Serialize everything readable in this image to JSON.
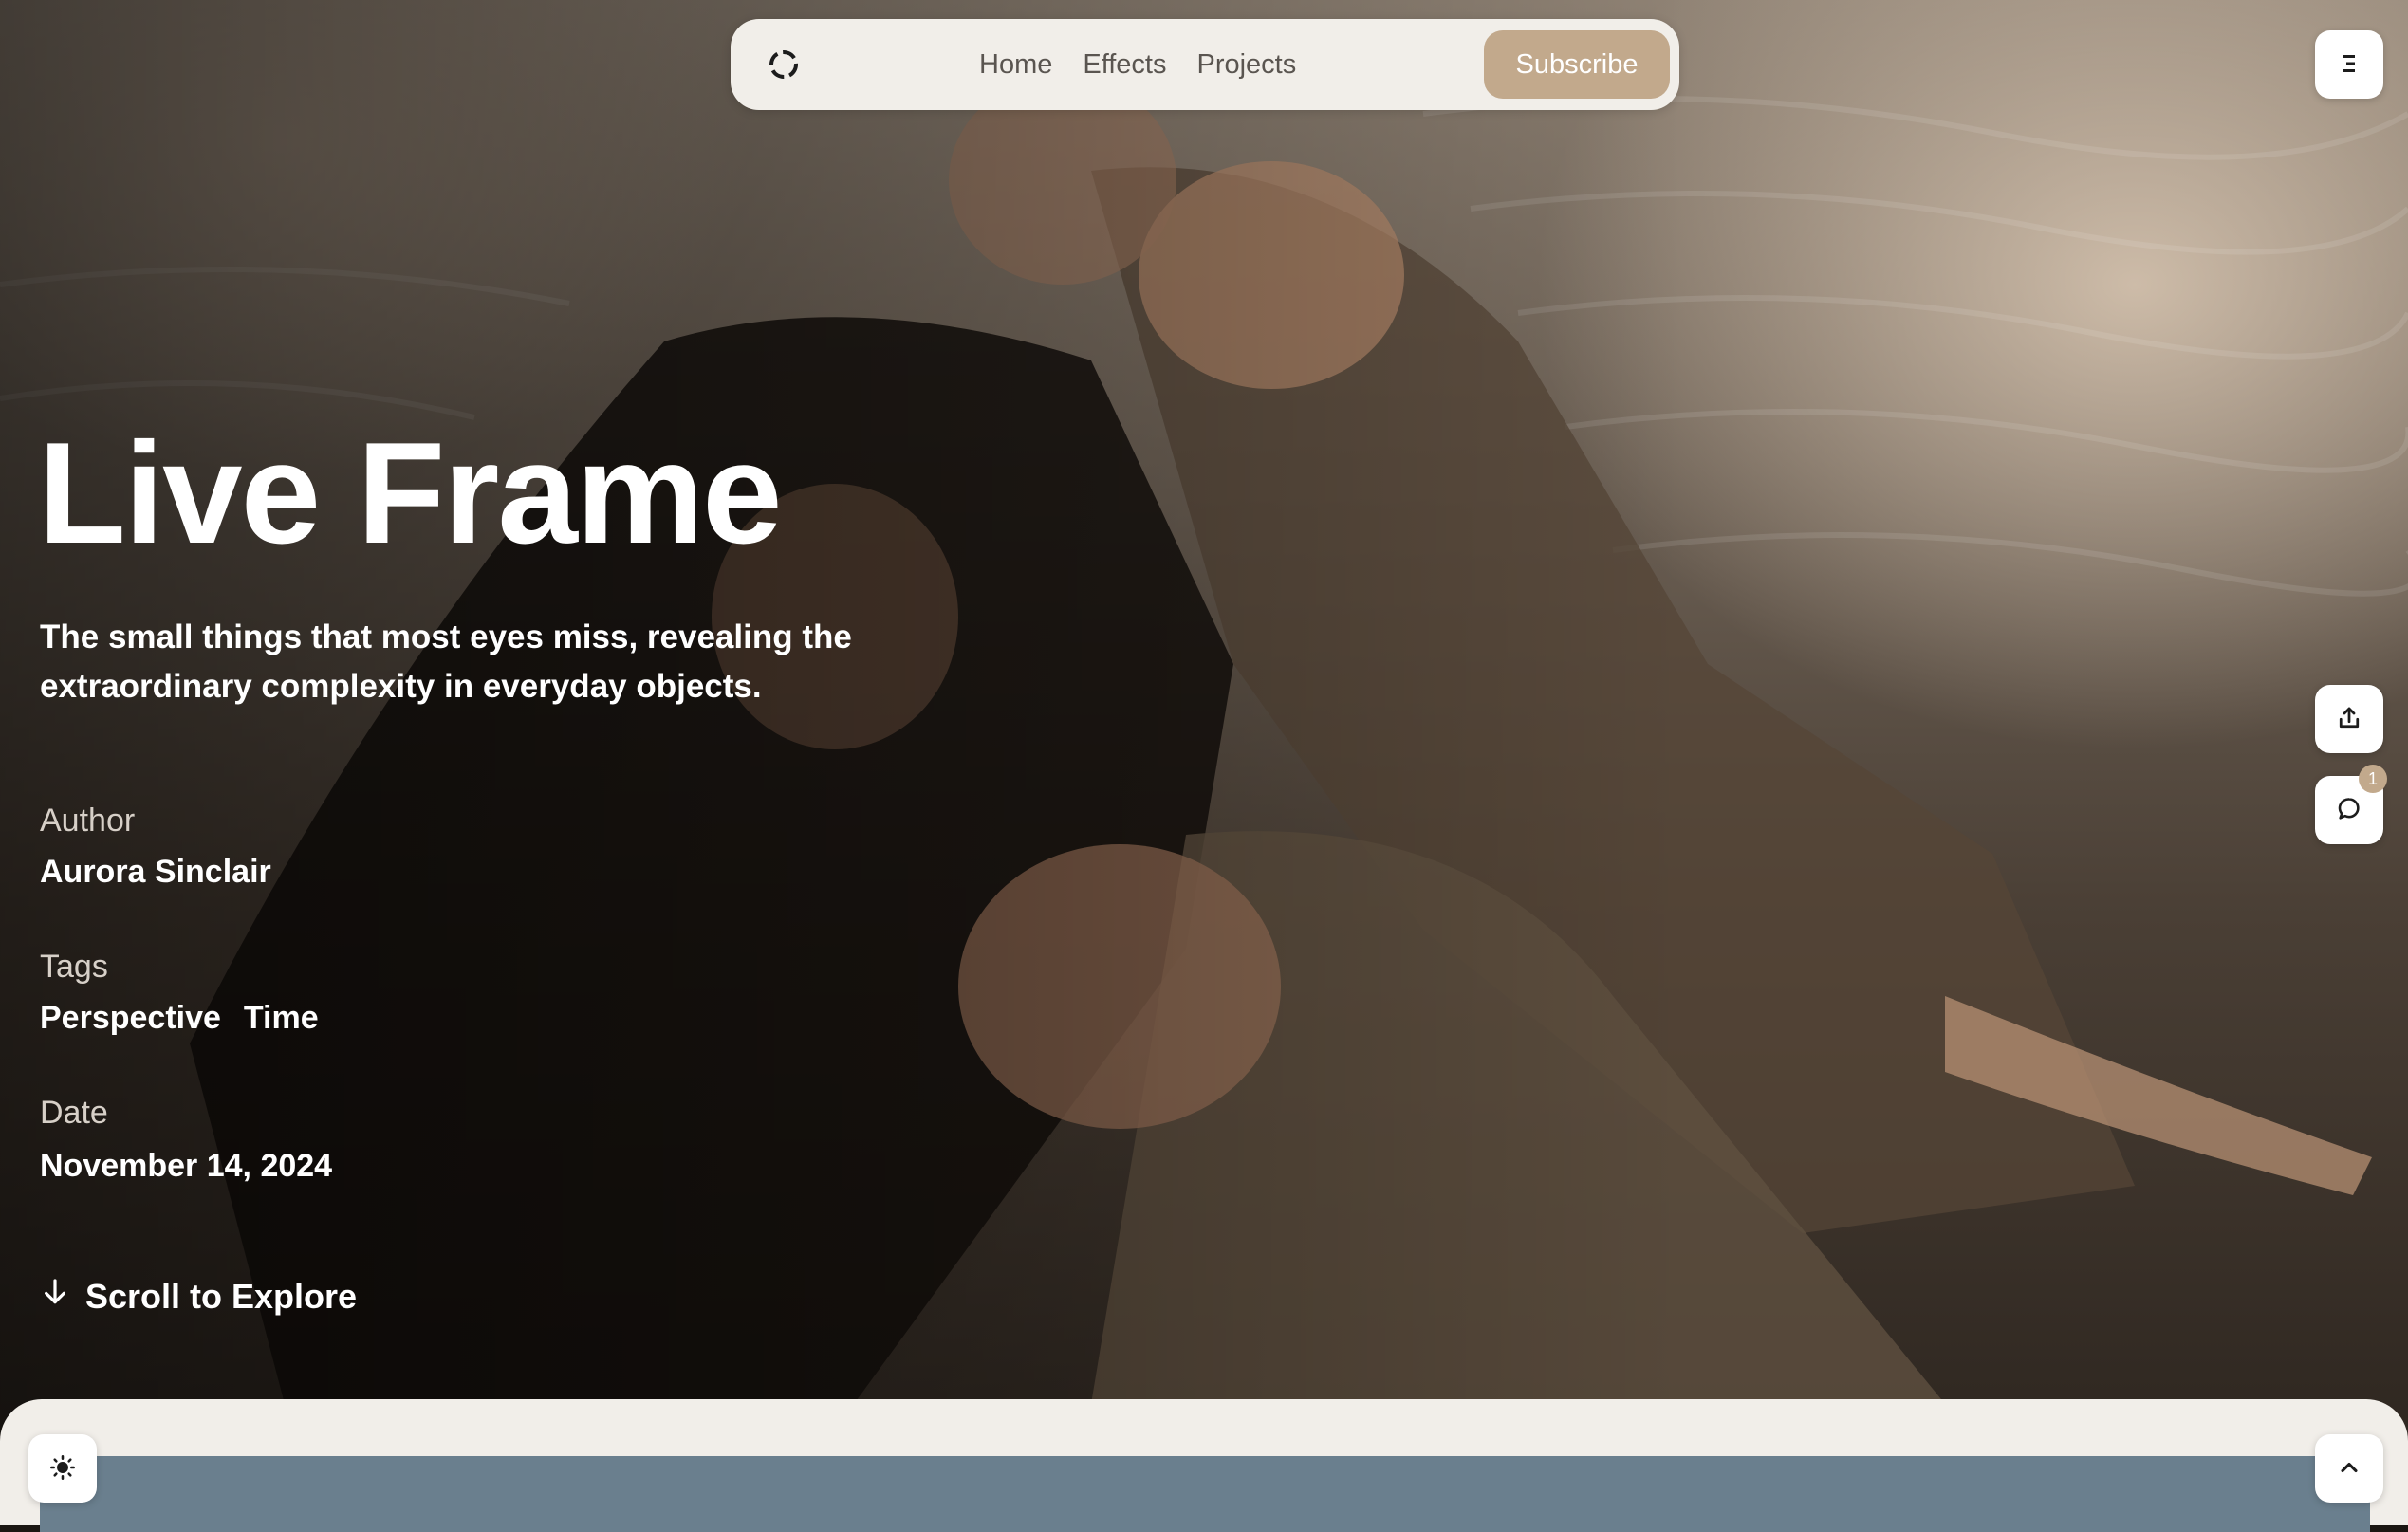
{
  "nav": {
    "links": [
      "Home",
      "Effects",
      "Projects"
    ],
    "subscribe_label": "Subscribe"
  },
  "hero": {
    "title": "Live Frame",
    "subtitle": "The small things that most eyes miss, revealing the extraordinary complexity in everyday objects."
  },
  "meta": {
    "author_label": "Author",
    "author": "Aurora Sinclair",
    "tags_label": "Tags",
    "tags": [
      "Perspective",
      "Time"
    ],
    "date_label": "Date",
    "date": "November 14, 2024"
  },
  "scroll_label": "Scroll to Explore",
  "comments": {
    "count": "1"
  },
  "icons": {
    "logo": "loader-circle-icon",
    "menu": "menu-icon",
    "share": "share-icon",
    "comment": "comment-icon",
    "theme": "sun-icon",
    "scroll_top": "chevron-up-icon",
    "scroll_down": "arrow-down-icon"
  },
  "colors": {
    "accent": "#c2a98c",
    "nav_bg": "#f1eee9",
    "nav_text": "#5a5550",
    "panel_image": "#6a7f8e"
  }
}
